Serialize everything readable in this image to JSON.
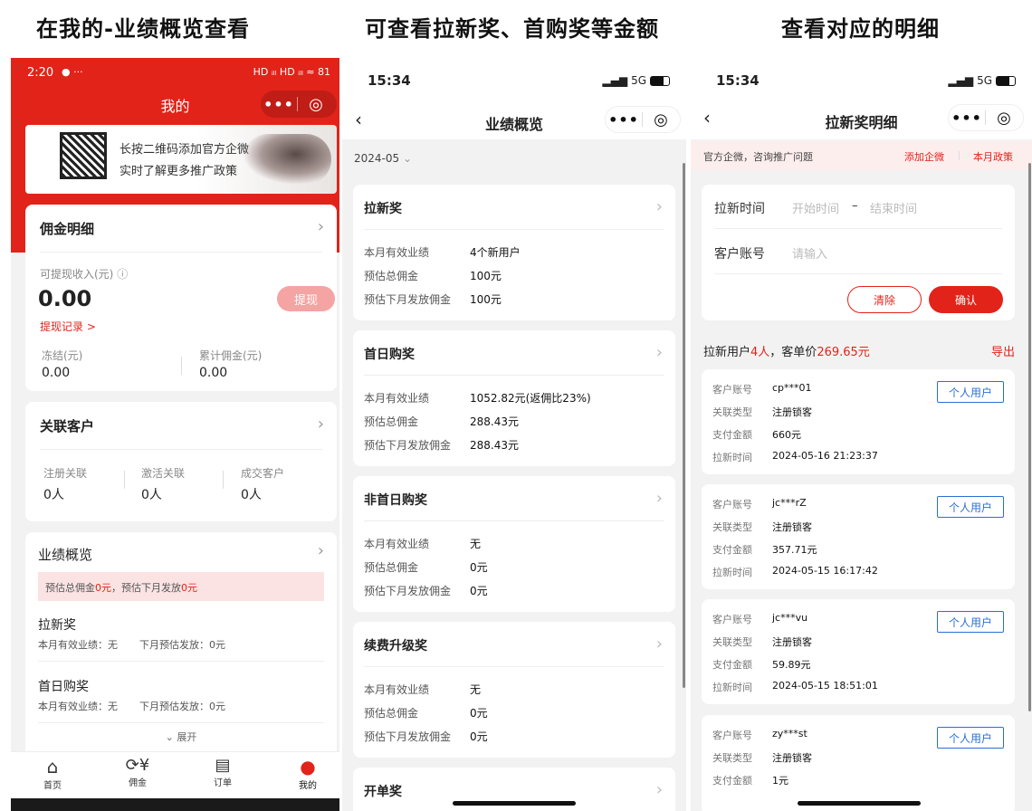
{
  "captions": [
    "在我的-业绩概览查看",
    "可查看拉新奖、首购奖等金额",
    "查看对应的明细"
  ],
  "p1": {
    "status_time": "2:20",
    "status_icons": "HD ᵢₗₗ HD ᵢₗₗ ≈ 81",
    "title": "我的",
    "banner_line1": "长按二维码添加官方企微",
    "banner_line2": "实时了解更多推广政策",
    "commission": {
      "title": "佣金明细",
      "withdrawable_label": "可提现收入(元)",
      "withdrawable_value": "0.00",
      "withdraw_button": "提现",
      "withdraw_record": "提现记录 >",
      "frozen_label": "冻结(元)",
      "frozen_value": "0.00",
      "total_label": "累计佣金(元)",
      "total_value": "0.00"
    },
    "customers": {
      "title": "关联客户",
      "stats": [
        {
          "label": "注册关联",
          "value": "0人"
        },
        {
          "label": "激活关联",
          "value": "0人"
        },
        {
          "label": "成交客户",
          "value": "0人"
        }
      ]
    },
    "performance": {
      "title": "业绩概览",
      "notice_a": "预估总佣金",
      "notice_b": "0元",
      "notice_c": "，预估下月发放",
      "notice_d": "0元",
      "items": [
        {
          "name": "拉新奖",
          "desc1": "本月有效业绩：无",
          "desc2": "下月预估发放：0元"
        },
        {
          "name": "首日购奖",
          "desc1": "本月有效业绩：无",
          "desc2": "下月预估发放：0元"
        }
      ],
      "expand": "展开"
    },
    "tabs": [
      {
        "label": "首页"
      },
      {
        "label": "佣金"
      },
      {
        "label": "订单"
      },
      {
        "label": "我的"
      }
    ]
  },
  "p2": {
    "status_time": "15:34",
    "network": "5G",
    "title": "业绩概览",
    "month": "2024-05",
    "sections": [
      {
        "title": "拉新奖",
        "rows": [
          [
            "本月有效业绩",
            "4个新用户"
          ],
          [
            "预估总佣金",
            "100元"
          ],
          [
            "预估下月发放佣金",
            "100元"
          ]
        ]
      },
      {
        "title": "首日购奖",
        "rows": [
          [
            "本月有效业绩",
            "1052.82元(返佣比23%)"
          ],
          [
            "预估总佣金",
            "288.43元"
          ],
          [
            "预估下月发放佣金",
            "288.43元"
          ]
        ]
      },
      {
        "title": "非首日购奖",
        "rows": [
          [
            "本月有效业绩",
            "无"
          ],
          [
            "预估总佣金",
            "0元"
          ],
          [
            "预估下月发放佣金",
            "0元"
          ]
        ]
      },
      {
        "title": "续费升级奖",
        "rows": [
          [
            "本月有效业绩",
            "无"
          ],
          [
            "预估总佣金",
            "0元"
          ],
          [
            "预估下月发放佣金",
            "0元"
          ]
        ]
      },
      {
        "title": "开单奖",
        "rows": []
      }
    ]
  },
  "p3": {
    "status_time": "15:34",
    "network": "5G",
    "title": "拉新奖明细",
    "notice": "官方企微，咨询推广问题",
    "add_wecom": "添加企微",
    "monthly_policy": "本月政策",
    "filter": {
      "time_label": "拉新时间",
      "start_ph": "开始时间",
      "dash": "–",
      "end_ph": "结束时间",
      "account_label": "客户账号",
      "account_ph": "请输入",
      "clear": "清除",
      "confirm": "确认"
    },
    "summary_a": "拉新用户",
    "summary_count": "4人",
    "summary_b": "，客单价",
    "summary_price": "269.65元",
    "export": "导出",
    "field_labels": [
      "客户账号",
      "关联类型",
      "支付金额",
      "拉新时间"
    ],
    "tag": "个人用户",
    "records": [
      {
        "account": "cp***01",
        "type": "注册锁客",
        "amount": "660元",
        "time": "2024-05-16 21:23:37"
      },
      {
        "account": "jc***rZ",
        "type": "注册锁客",
        "amount": "357.71元",
        "time": "2024-05-15 16:17:42"
      },
      {
        "account": "jc***vu",
        "type": "注册锁客",
        "amount": "59.89元",
        "time": "2024-05-15 18:51:01"
      },
      {
        "account": "zy***st",
        "type": "注册锁客",
        "amount": "1元",
        "time": ""
      }
    ]
  }
}
